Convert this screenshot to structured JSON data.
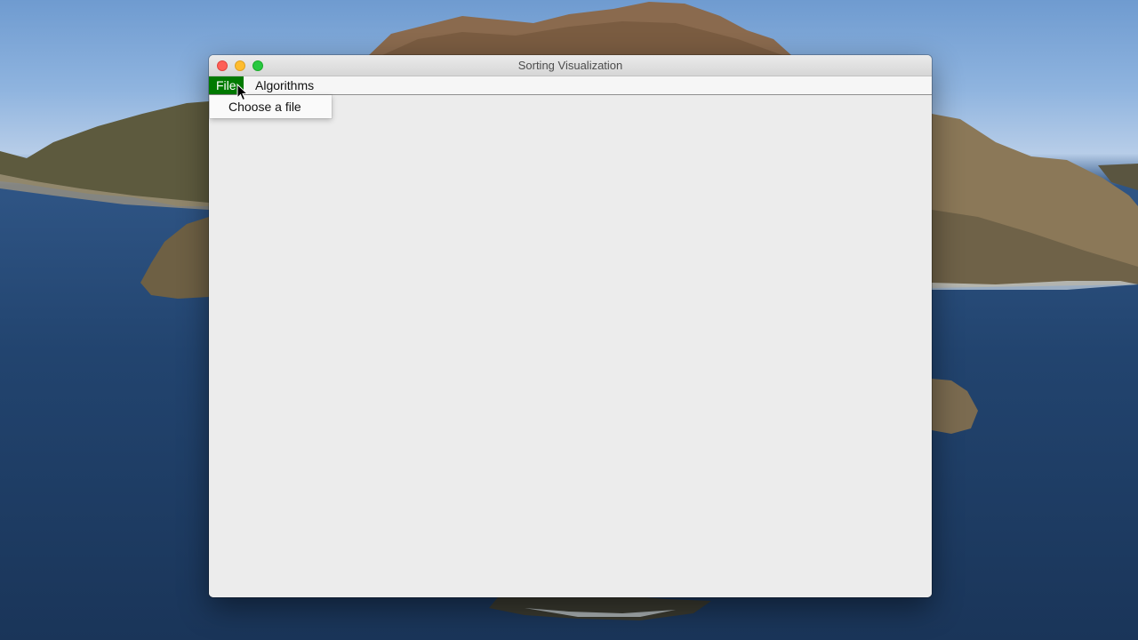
{
  "window": {
    "title": "Sorting Visualization"
  },
  "menubar": {
    "items": [
      {
        "label": "File",
        "state": "open"
      },
      {
        "label": "Algorithms"
      }
    ]
  },
  "file_menu": {
    "items": [
      {
        "label": "Choose a file"
      }
    ]
  },
  "icons": {
    "close": "close-traffic-light",
    "minimize": "minimize-traffic-light",
    "zoom": "zoom-traffic-light",
    "cursor": "arrow-cursor-icon"
  },
  "colors": {
    "menu_selected": "#007a00",
    "close": "#fe5f57",
    "minimize": "#febc2e",
    "zoom": "#28c840"
  }
}
